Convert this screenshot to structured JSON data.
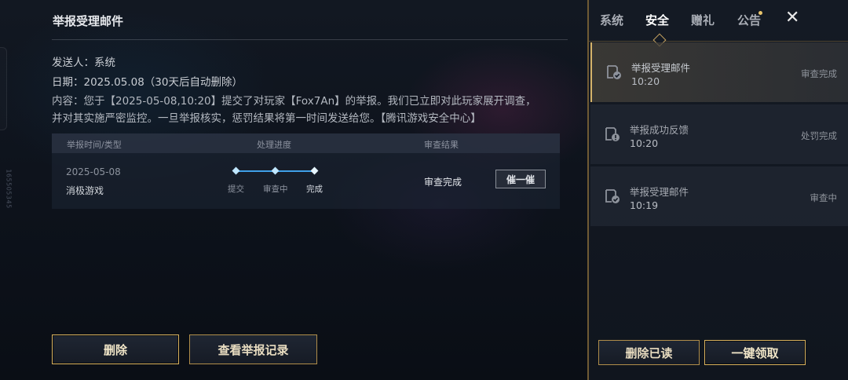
{
  "side_id": "165505345",
  "mail": {
    "title": "举报受理邮件",
    "sender": "发送人：系统",
    "date": "日期：2025.05.08（30天后自动删除）",
    "content_line1": "内容：您于【2025-05-08,10:20】提交了对玩家【Fox7An】的举报。我们已立即对此玩家展开调查，",
    "content_line2": "并对其实施严密监控。一旦举报核实，惩罚结果将第一时间发送给您。【腾讯游戏安全中心】"
  },
  "table": {
    "headers": [
      "举报时间/类型",
      "处理进度",
      "审查结果"
    ],
    "row": {
      "date": "2025-05-08",
      "type": "消极游戏",
      "steps": [
        "提交",
        "审查中",
        "完成"
      ],
      "progress_completed_steps": 3,
      "result": "审查完成",
      "urge_label": "催一催"
    }
  },
  "buttons": {
    "delete": "删除",
    "view_records": "查看举报记录",
    "delete_read": "删除已读",
    "claim_all": "一键领取"
  },
  "tabs": [
    {
      "label": "系统",
      "active": false
    },
    {
      "label": "安全",
      "active": true
    },
    {
      "label": "赠礼",
      "active": false
    },
    {
      "label": "公告",
      "active": false,
      "has_badge": true
    }
  ],
  "close_label": "✕",
  "mail_list": [
    {
      "title": "举报受理邮件",
      "time": "10:20",
      "status": "审查完成",
      "icon": "check-mail-icon",
      "selected": true
    },
    {
      "title": "举报成功反馈",
      "time": "10:20",
      "status": "处罚完成",
      "icon": "alert-mail-icon",
      "selected": false
    },
    {
      "title": "举报受理邮件",
      "time": "10:19",
      "status": "审查中",
      "icon": "check-mail-icon",
      "selected": false
    }
  ],
  "colors": {
    "accent_gold": "#d9b25e",
    "progress_blue": "#3fa0e8",
    "background": "#0b0f16"
  }
}
